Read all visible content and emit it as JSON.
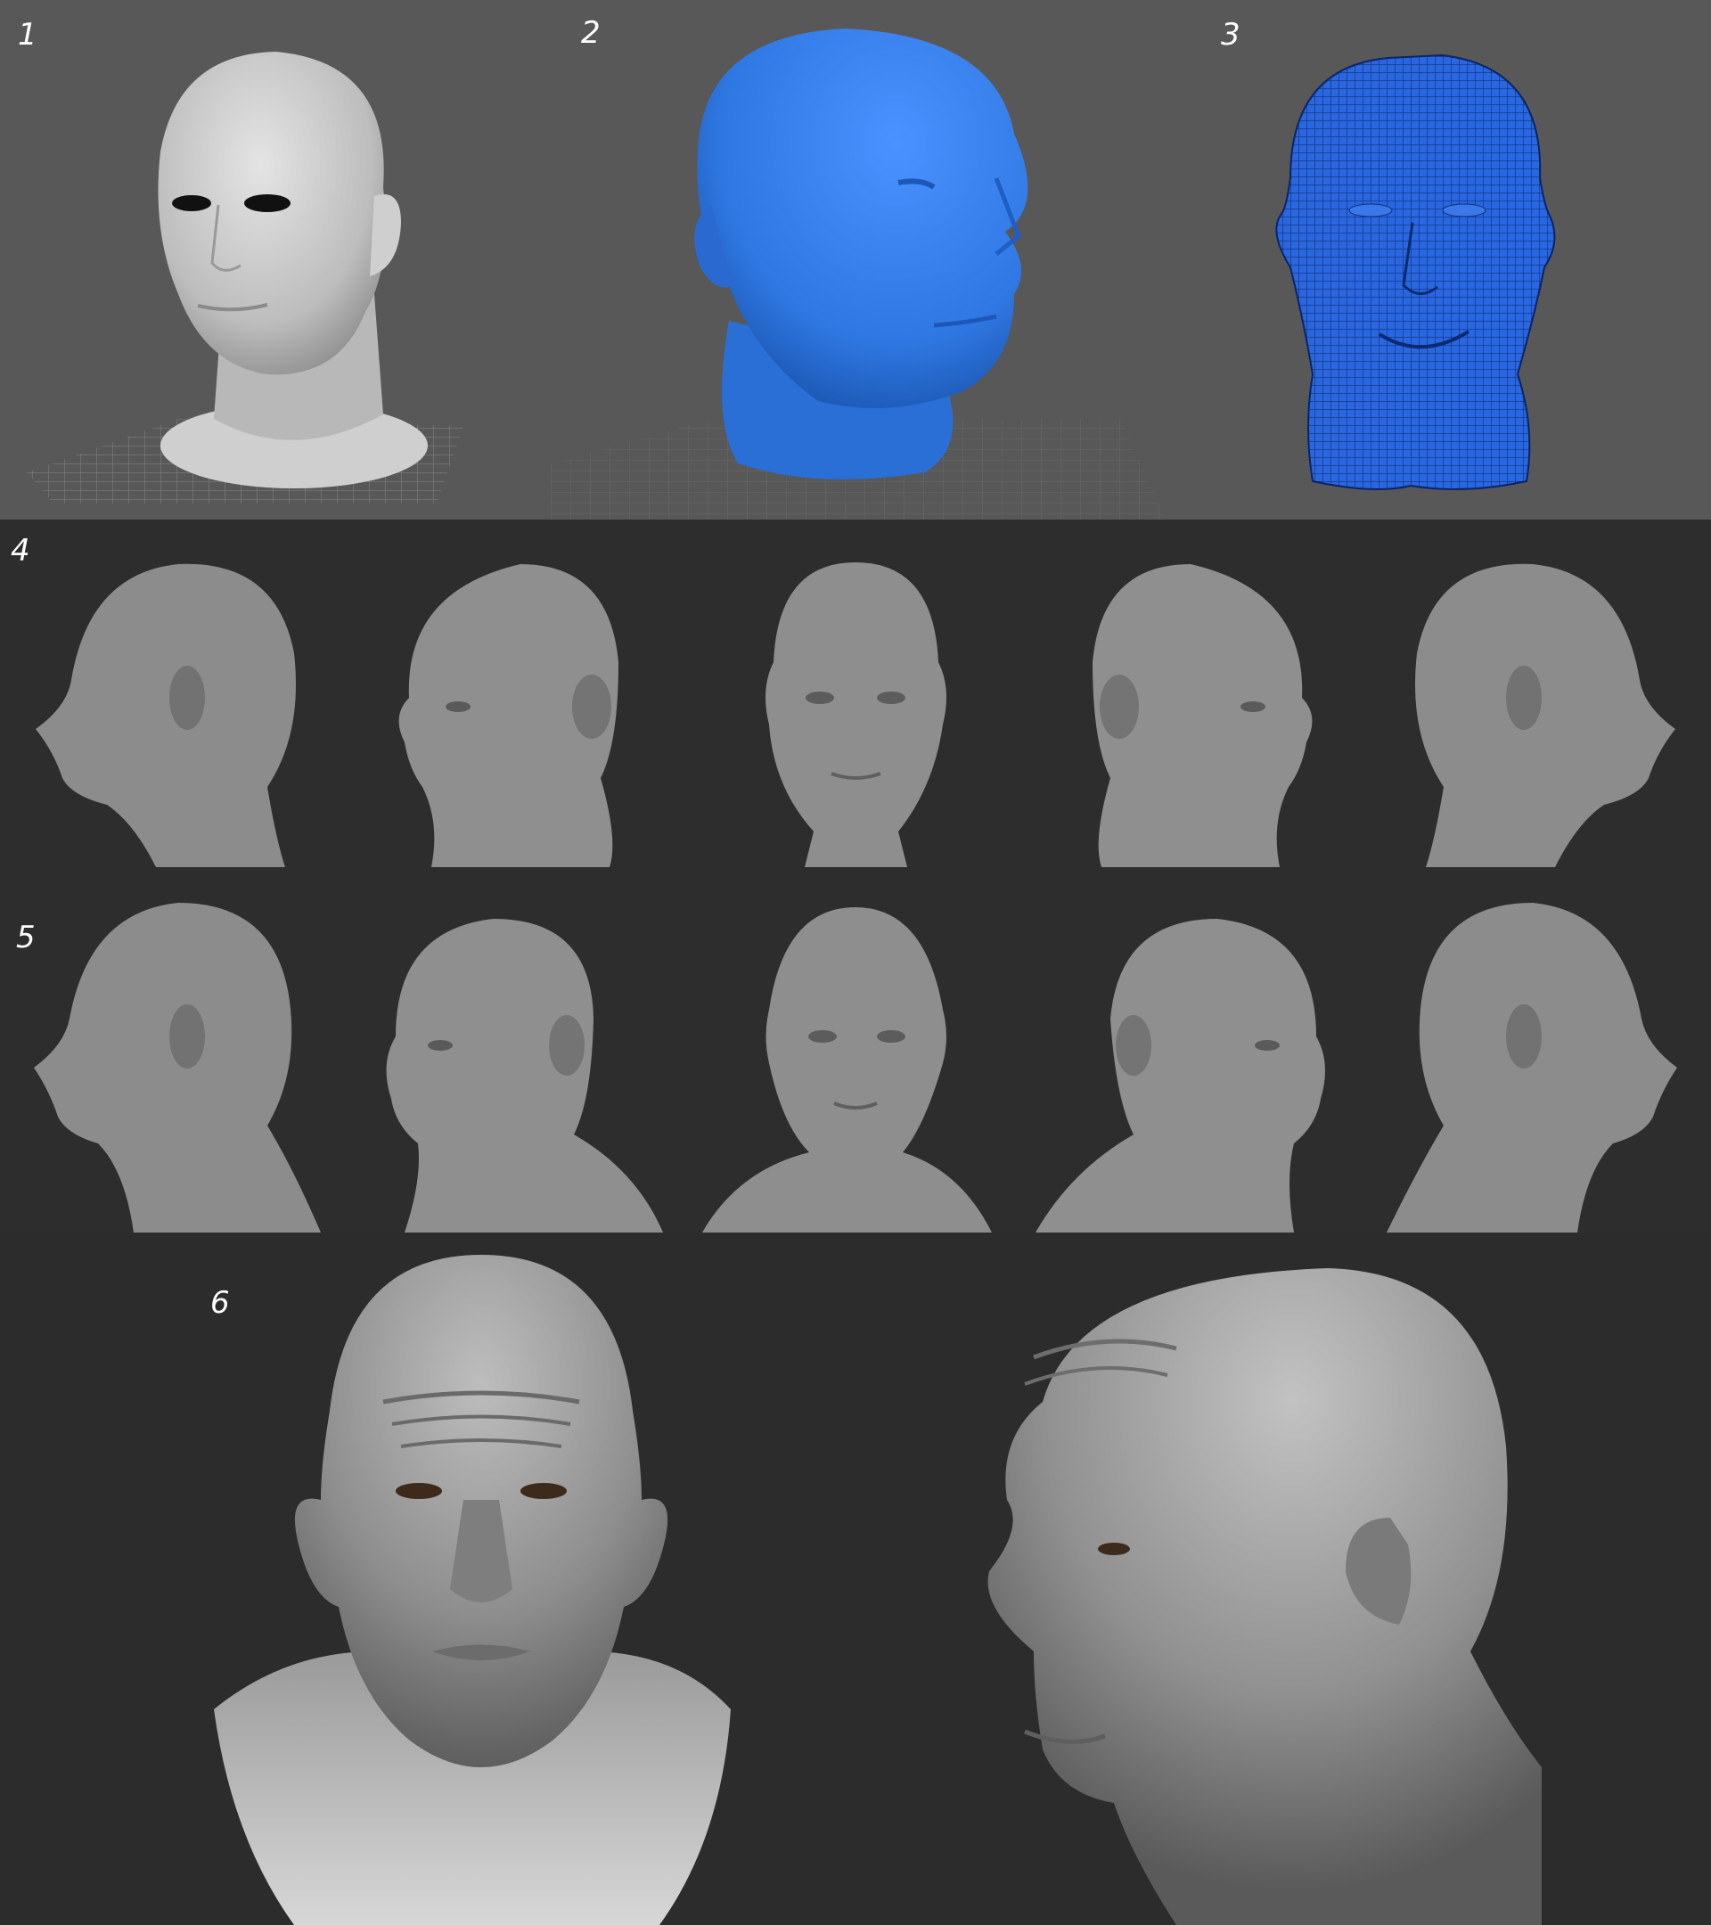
{
  "steps": [
    {
      "label": "1",
      "stage": "base-mesh"
    },
    {
      "label": "2",
      "stage": "blockout"
    },
    {
      "label": "3",
      "stage": "wireframe"
    },
    {
      "label": "4",
      "stage": "head-turnaround"
    },
    {
      "label": "5",
      "stage": "bust-turnaround"
    },
    {
      "label": "6",
      "stage": "final-detail"
    }
  ],
  "colors": {
    "top_background": "#585858",
    "dark_background": "#2d2d2e",
    "clay": "#8c8c8c",
    "blockout_blue": "#2f78e3",
    "wire_blue": "#2560d8",
    "label": "#ffffff"
  },
  "turnaround_views": [
    "left-profile",
    "left-three-quarter",
    "front",
    "right-three-quarter",
    "right-profile"
  ]
}
